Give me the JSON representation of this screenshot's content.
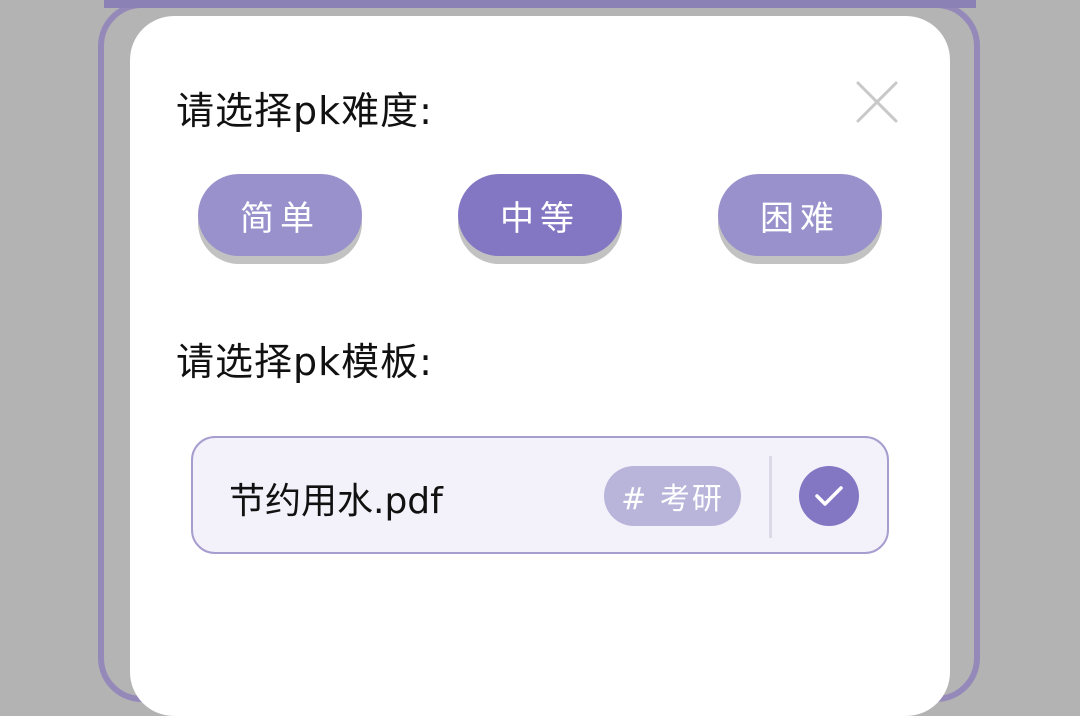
{
  "colors": {
    "backdrop": "#b3b3b3",
    "accent": "#8377c4",
    "accent_light": "#9891cc",
    "tag_bg": "#b9b4da",
    "card_bg": "#f3f1f9"
  },
  "dialog": {
    "difficulty_title": "请选择pk难度:",
    "close_icon": "close-icon",
    "difficulty_options": [
      {
        "label": "简单",
        "selected": false
      },
      {
        "label": "中等",
        "selected": true
      },
      {
        "label": "困难",
        "selected": false
      }
    ],
    "template_title": "请选择pk模板:",
    "templates": [
      {
        "name": "节约用水.pdf",
        "tag": "# 考研",
        "checked": true,
        "check_icon": "check-icon"
      }
    ]
  }
}
